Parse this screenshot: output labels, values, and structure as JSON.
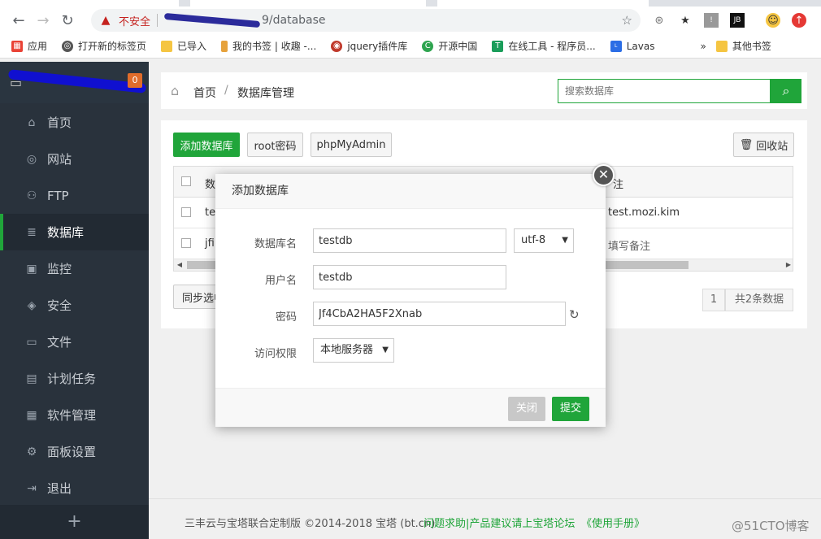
{
  "browser": {
    "insecure_label": "不安全",
    "url_path": "9/database",
    "bookmarks": [
      {
        "label": "应用",
        "color": "#e94235"
      },
      {
        "label": "打开新的标签页",
        "color": "#555555"
      },
      {
        "label": "已导入",
        "color": "#f5c542"
      },
      {
        "label": "我的书签 | 收趣 -...",
        "color": "#e6a23c"
      },
      {
        "label": "jquery插件库",
        "color": "#c0392b"
      },
      {
        "label": "开源中国",
        "color": "#2ea44f"
      },
      {
        "label": "在线工具 - 程序员...",
        "color": "#1a9d5a"
      },
      {
        "label": "Lavas",
        "color": "#2b6de5"
      }
    ],
    "more_bookmarks": "»",
    "other_bookmarks": "其他书签"
  },
  "sidebar": {
    "badge_count": "0",
    "items": [
      {
        "label": "首页",
        "icon": "home-icon",
        "glyph": "⌂"
      },
      {
        "label": "网站",
        "icon": "globe-icon",
        "glyph": "◎"
      },
      {
        "label": "FTP",
        "icon": "ftp-icon",
        "glyph": "⚇"
      },
      {
        "label": "数据库",
        "icon": "database-icon",
        "glyph": "≣"
      },
      {
        "label": "监控",
        "icon": "monitor-icon",
        "glyph": "▣"
      },
      {
        "label": "安全",
        "icon": "shield-icon",
        "glyph": "◈"
      },
      {
        "label": "文件",
        "icon": "folder-icon",
        "glyph": "▭"
      },
      {
        "label": "计划任务",
        "icon": "calendar-icon",
        "glyph": "▤"
      },
      {
        "label": "软件管理",
        "icon": "apps-icon",
        "glyph": "▦"
      },
      {
        "label": "面板设置",
        "icon": "gear-icon",
        "glyph": "⚙"
      },
      {
        "label": "退出",
        "icon": "logout-icon",
        "glyph": "⇥"
      }
    ],
    "add_label": "+"
  },
  "header": {
    "crumb_home": "首页",
    "crumb_sep": "/",
    "crumb_current": "数据库管理",
    "search_placeholder": "搜索数据库"
  },
  "toolbar": {
    "add_db": "添加数据库",
    "root_pwd": "root密码",
    "phpmyadmin": "phpMyAdmin",
    "recycle": "回收站"
  },
  "table": {
    "header_partial": "数",
    "header_note": "注",
    "rows": [
      {
        "name_partial": "tes",
        "note": "test.mozi.kim"
      },
      {
        "name_partial": "jfi",
        "note": "填写备注"
      }
    ]
  },
  "sync_btn": "同步选中",
  "pagination": {
    "page": "1",
    "total": "共2条数据"
  },
  "modal": {
    "title": "添加数据库",
    "db_name_label": "数据库名",
    "db_name_value": "testdb",
    "charset": "utf-8",
    "user_label": "用户名",
    "user_value": "testdb",
    "pwd_label": "密码",
    "pwd_value": "Jf4CbA2HA5F2Xnab",
    "access_label": "访问权限",
    "access_value": "本地服务器",
    "close_btn": "关闭",
    "submit_btn": "提交"
  },
  "footer": {
    "copyright": "三丰云与宝塔联合定制版 ©2014-2018 宝塔 (bt.cn)",
    "forum": "问题求助|产品建议请上宝塔论坛",
    "manual": "《使用手册》",
    "watermark": "@51CTO博客"
  },
  "colors": {
    "accent": "#20a53a",
    "sidebar": "#29323c",
    "badge": "#e06c2b"
  }
}
